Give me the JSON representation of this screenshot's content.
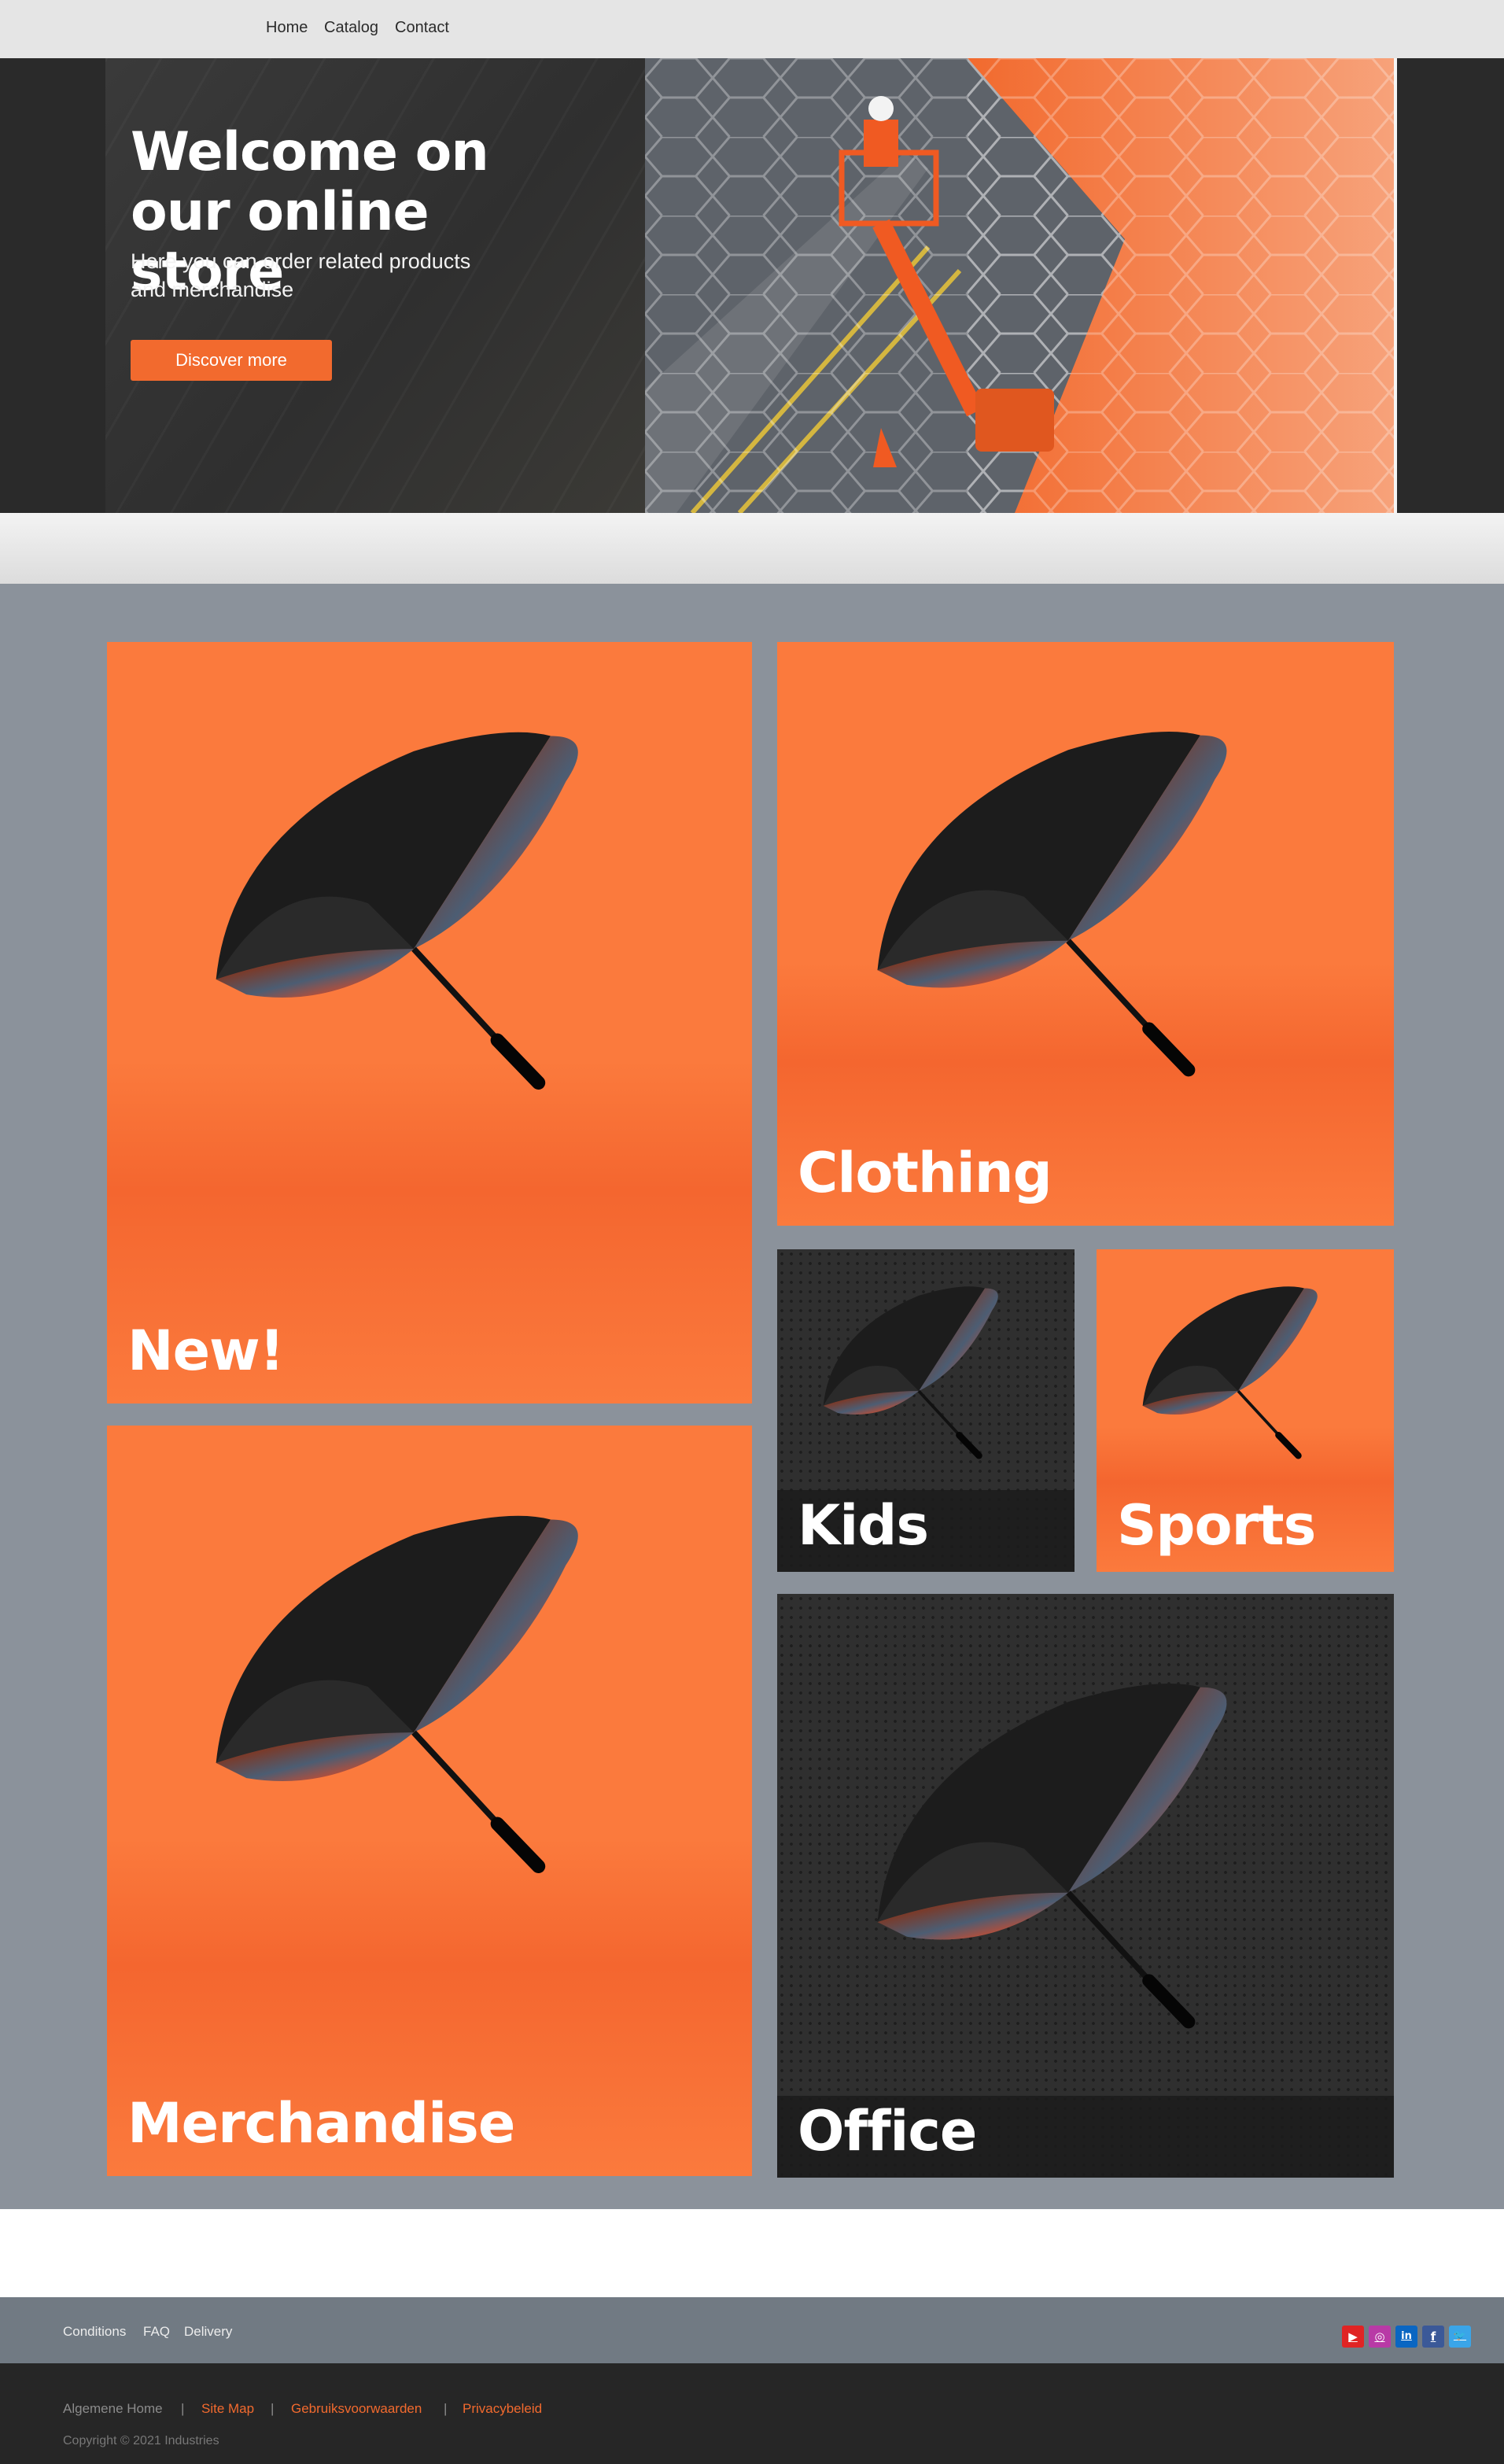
{
  "nav": {
    "home": "Home",
    "catalog": "Catalog",
    "contact": "Contact"
  },
  "hero": {
    "title": "Welcome on our online store",
    "subtitle": "Here you can order related products and merchandise",
    "button": "Discover more"
  },
  "tiles": {
    "new": "New!",
    "clothing": "Clothing",
    "kids": "Kids",
    "sports": "Sports",
    "merchandise": "Merchandise",
    "office": "Office"
  },
  "footer": {
    "links": [
      "Conditions",
      "FAQ",
      "Delivery"
    ],
    "bottom_links": [
      "Algemene Home",
      "Site Map",
      "Gebruiksvoorwaarden",
      "Privacybeleid"
    ],
    "separator": "|",
    "copyright": "Copyright © 2021 Industries",
    "social": [
      {
        "icon": "youtube-icon",
        "glyph": "▶",
        "color": "#e02424"
      },
      {
        "icon": "instagram-icon",
        "glyph": "◎",
        "color": "#b83aa6"
      },
      {
        "icon": "linkedin-icon",
        "glyph": "in",
        "color": "#0a66c2"
      },
      {
        "icon": "facebook-icon",
        "glyph": "f",
        "color": "#3b5998"
      },
      {
        "icon": "twitter-icon",
        "glyph": "🐦",
        "color": "#3aa5e8"
      }
    ]
  },
  "colors": {
    "accent": "#f26a2e",
    "tile_orange": "#fb7a3d",
    "tiles_bg": "#8b929b",
    "footer_top": "#717a83",
    "footer_bottom": "#262626"
  }
}
